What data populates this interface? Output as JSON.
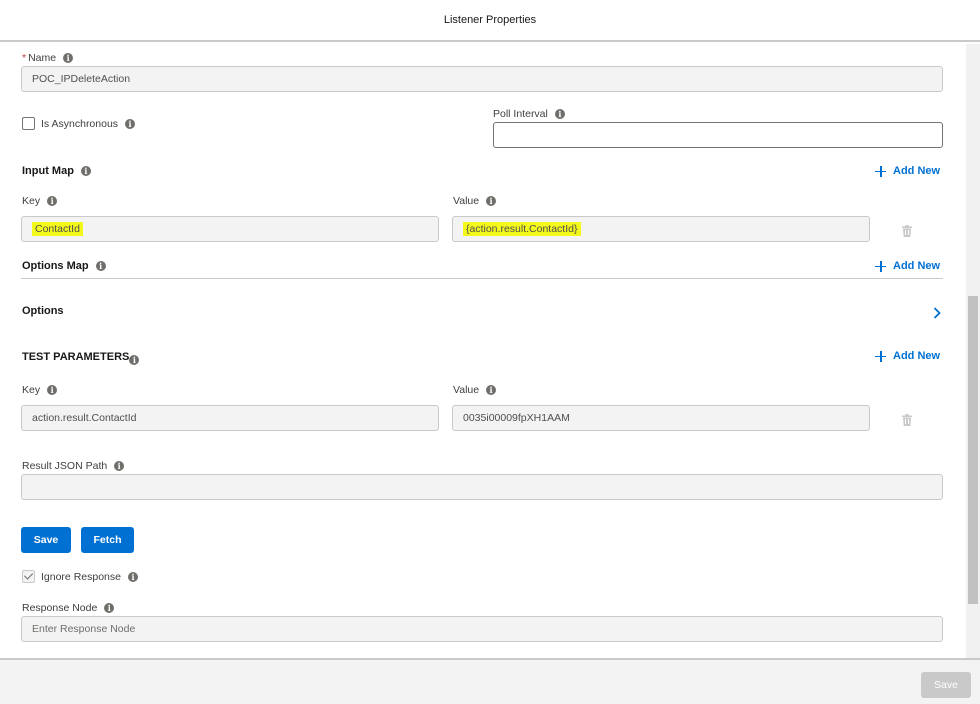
{
  "header": {
    "title": "Listener Properties"
  },
  "name_field": {
    "label": "Name",
    "required_mark": "*",
    "value": "POC_IPDeleteAction"
  },
  "is_async": {
    "label": "Is Asynchronous"
  },
  "poll_interval": {
    "label": "Poll Interval",
    "value": ""
  },
  "input_map": {
    "title": "Input Map",
    "add_new": "Add New",
    "key_label": "Key",
    "value_label": "Value",
    "rows": [
      {
        "key": "ContactId",
        "value": "{action.result.ContactId}"
      }
    ]
  },
  "options_map": {
    "title": "Options Map",
    "add_new": "Add New"
  },
  "options": {
    "title": "Options"
  },
  "test_parameters": {
    "title": "TEST PARAMETERS",
    "add_new": "Add New",
    "key_label": "Key",
    "value_label": "Value",
    "rows": [
      {
        "key": "action.result.ContactId",
        "value": "0035i00009fpXH1AAM"
      }
    ]
  },
  "result_json_path": {
    "label": "Result JSON Path",
    "value": ""
  },
  "buttons": {
    "save": "Save",
    "fetch": "Fetch"
  },
  "ignore_response": {
    "label": "Ignore Response",
    "checked": true
  },
  "response_node": {
    "label": "Response Node",
    "placeholder": "Enter Response Node"
  },
  "footer": {
    "save": "Save"
  },
  "colors": {
    "brand": "#0070d2",
    "highlight": "#f3f91b",
    "disabled": "#c9c9c9"
  }
}
